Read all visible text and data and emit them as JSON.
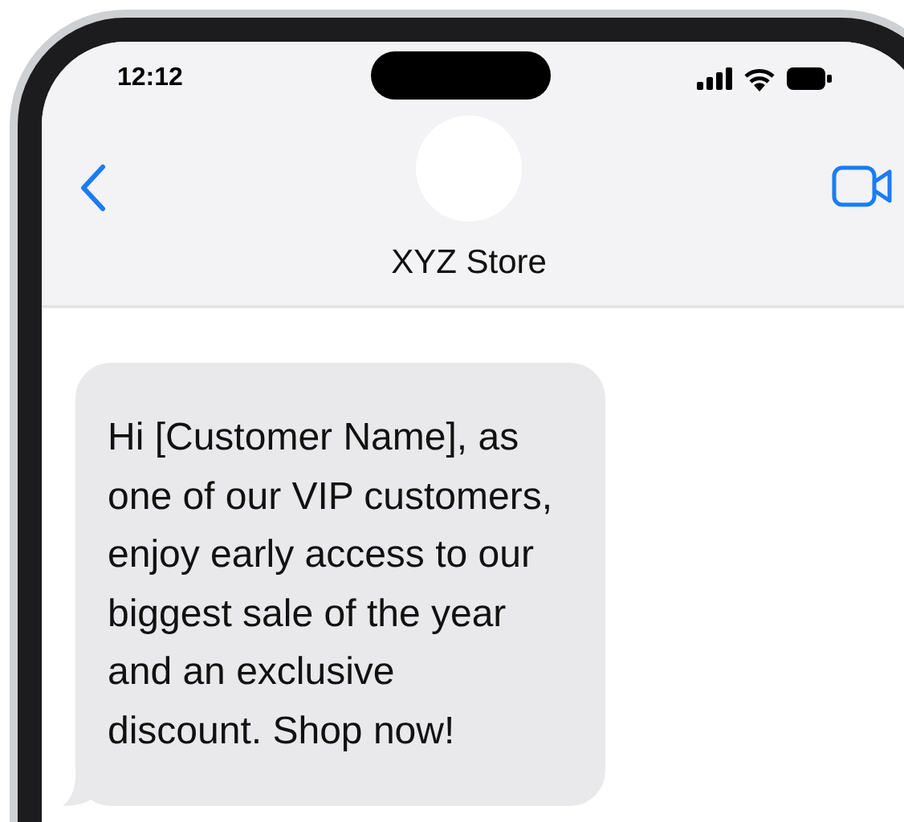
{
  "status_bar": {
    "time": "12:12"
  },
  "contact": {
    "name": "XYZ Store"
  },
  "messages": [
    {
      "kind": "incoming",
      "text": "Hi [Customer Name], as one of our VIP customers, enjoy early access to our biggest sale of the year and an exclusive discount. Shop now!"
    }
  ]
}
